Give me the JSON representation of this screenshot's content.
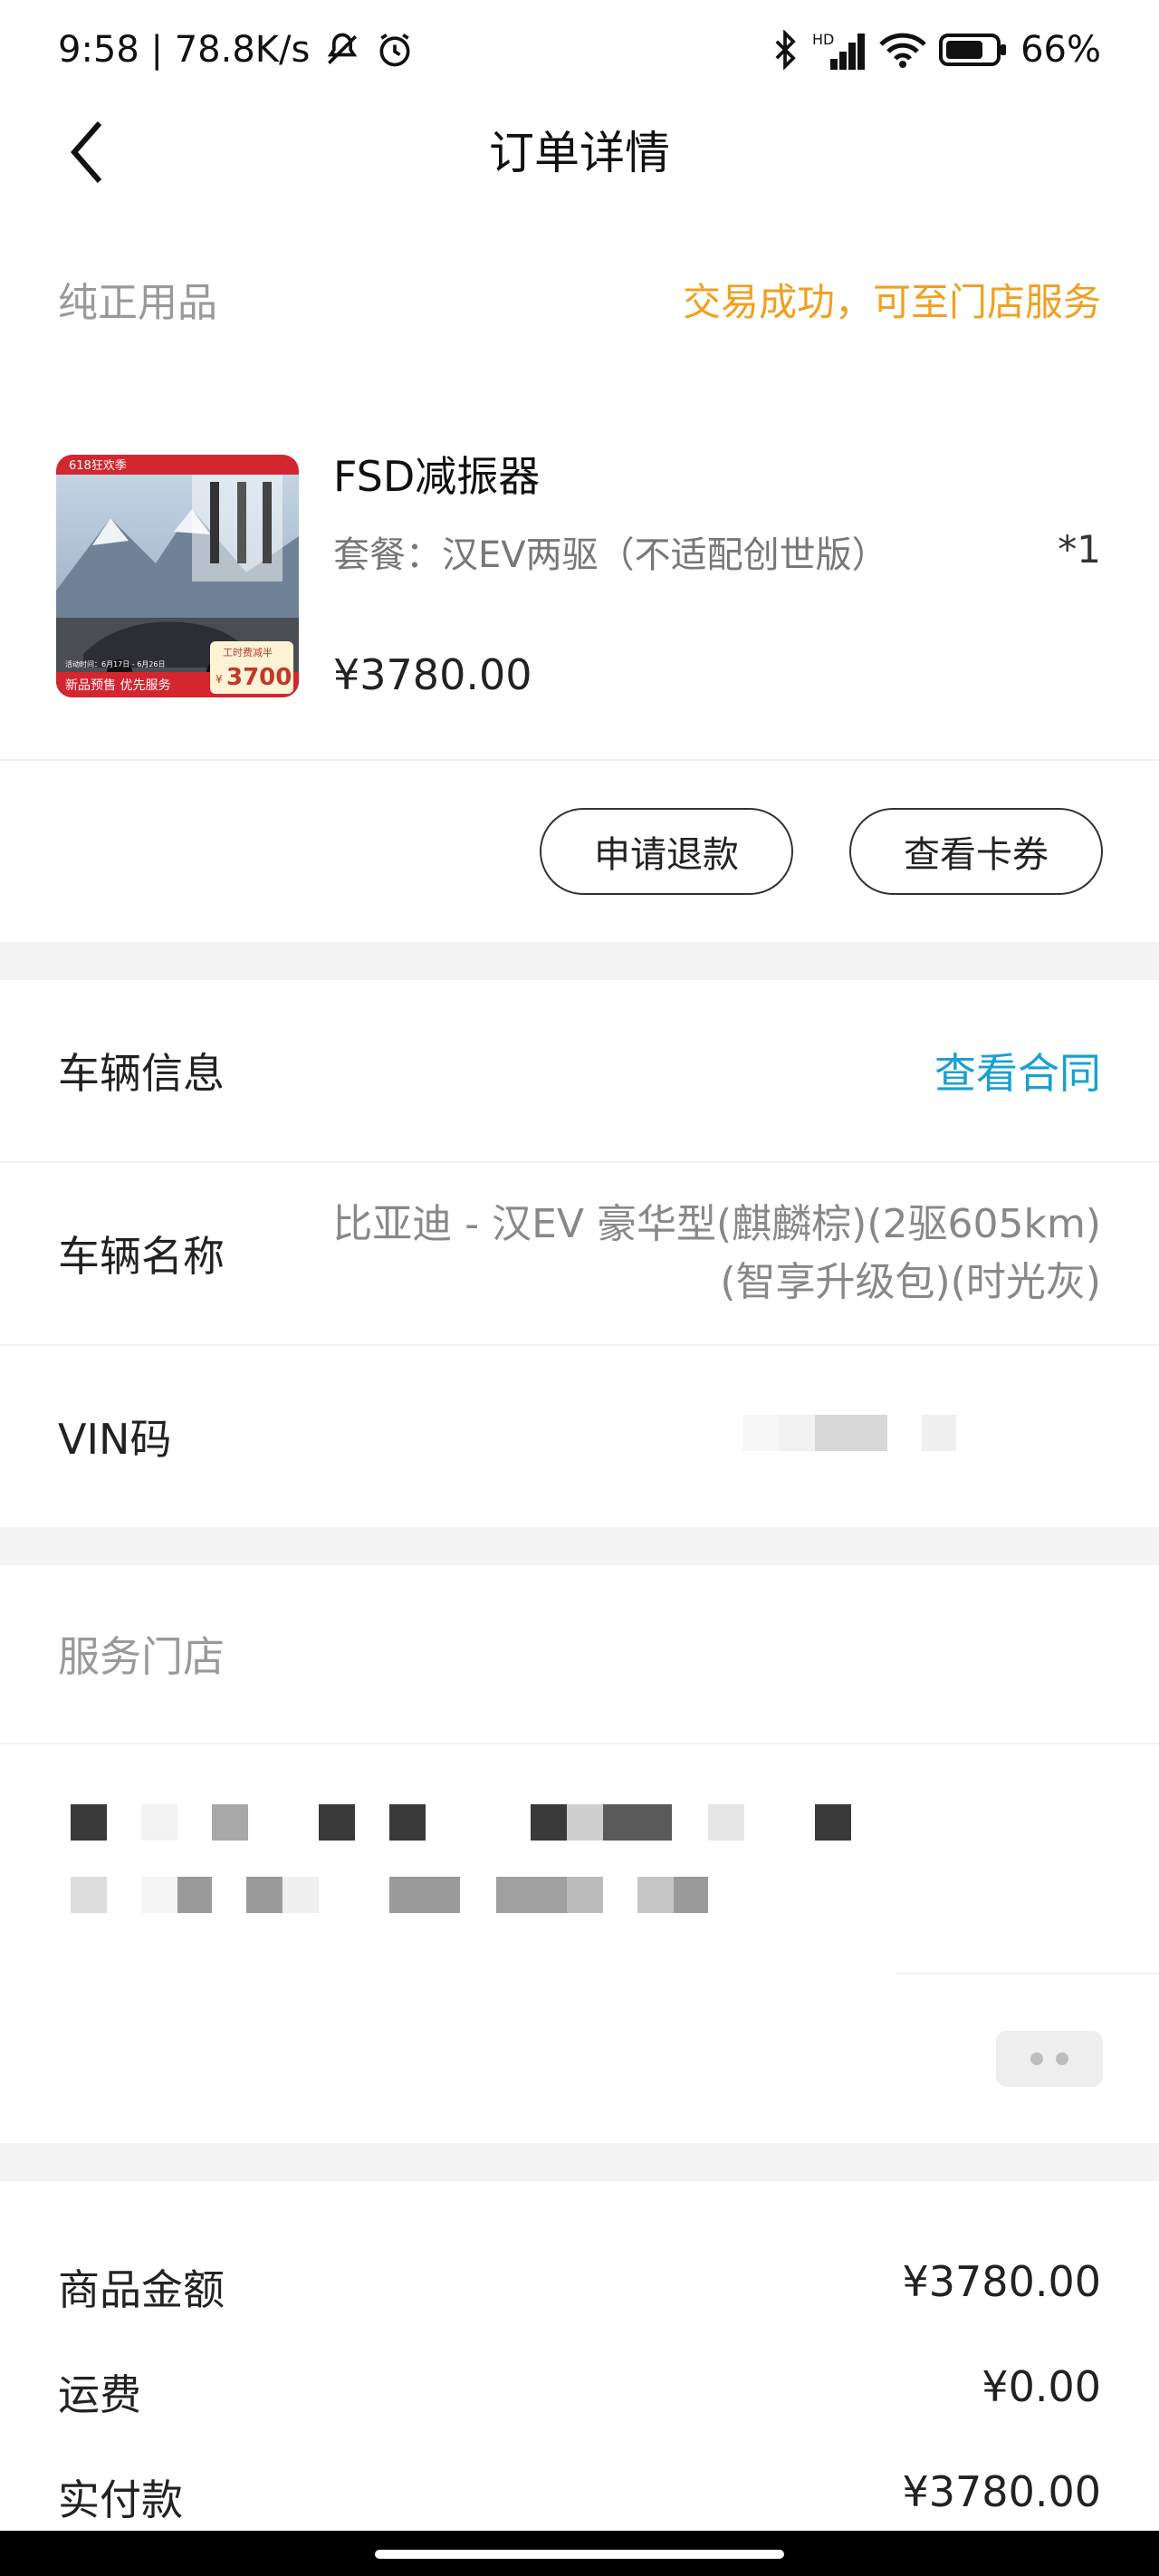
{
  "status_bar": {
    "time_speed": "9:58 | 78.8K/s",
    "network_label": "HD",
    "battery": "66%"
  },
  "header": {
    "title": "订单详情"
  },
  "order": {
    "category": "纯正用品",
    "status": "交易成功，可至门店服务"
  },
  "product": {
    "name": "FSD减振器",
    "spec": "套餐：汉EV两驱（不适配创世版）",
    "quantity": "*1",
    "price": "¥3780.00",
    "image": {
      "badge_top": "618狂欢季",
      "bottom_banner": "新品预售 优先服务",
      "promo_label": "工时费减半",
      "promo_price": "3700",
      "promo_currency": "¥",
      "date_range": "活动时间：6月17日 - 6月26日"
    }
  },
  "actions": {
    "refund": "申请退款",
    "coupon": "查看卡券"
  },
  "vehicle": {
    "section_title": "车辆信息",
    "contract_link": "查看合同",
    "name_label": "车辆名称",
    "name_line1": "比亚迪 - 汉EV 豪华型(麒麟棕)(2驱605km)",
    "name_line2": "(智享升级包)(时光灰)",
    "vin_label": "VIN码"
  },
  "service": {
    "section_title": "服务门店"
  },
  "summary": {
    "rows": [
      {
        "label": "商品金额",
        "value": "¥3780.00"
      },
      {
        "label": "运费",
        "value": "¥0.00"
      },
      {
        "label": "实付款",
        "value": "¥3780.00"
      }
    ]
  },
  "colors": {
    "status_orange": "#f0a020",
    "link_blue": "#1aa0d0",
    "divider_gray": "#f4f4f4"
  },
  "icons": [
    "back-arrow-icon",
    "mute-icon",
    "alarm-icon",
    "bluetooth-icon",
    "signal-icon",
    "wifi-icon",
    "battery-icon"
  ]
}
